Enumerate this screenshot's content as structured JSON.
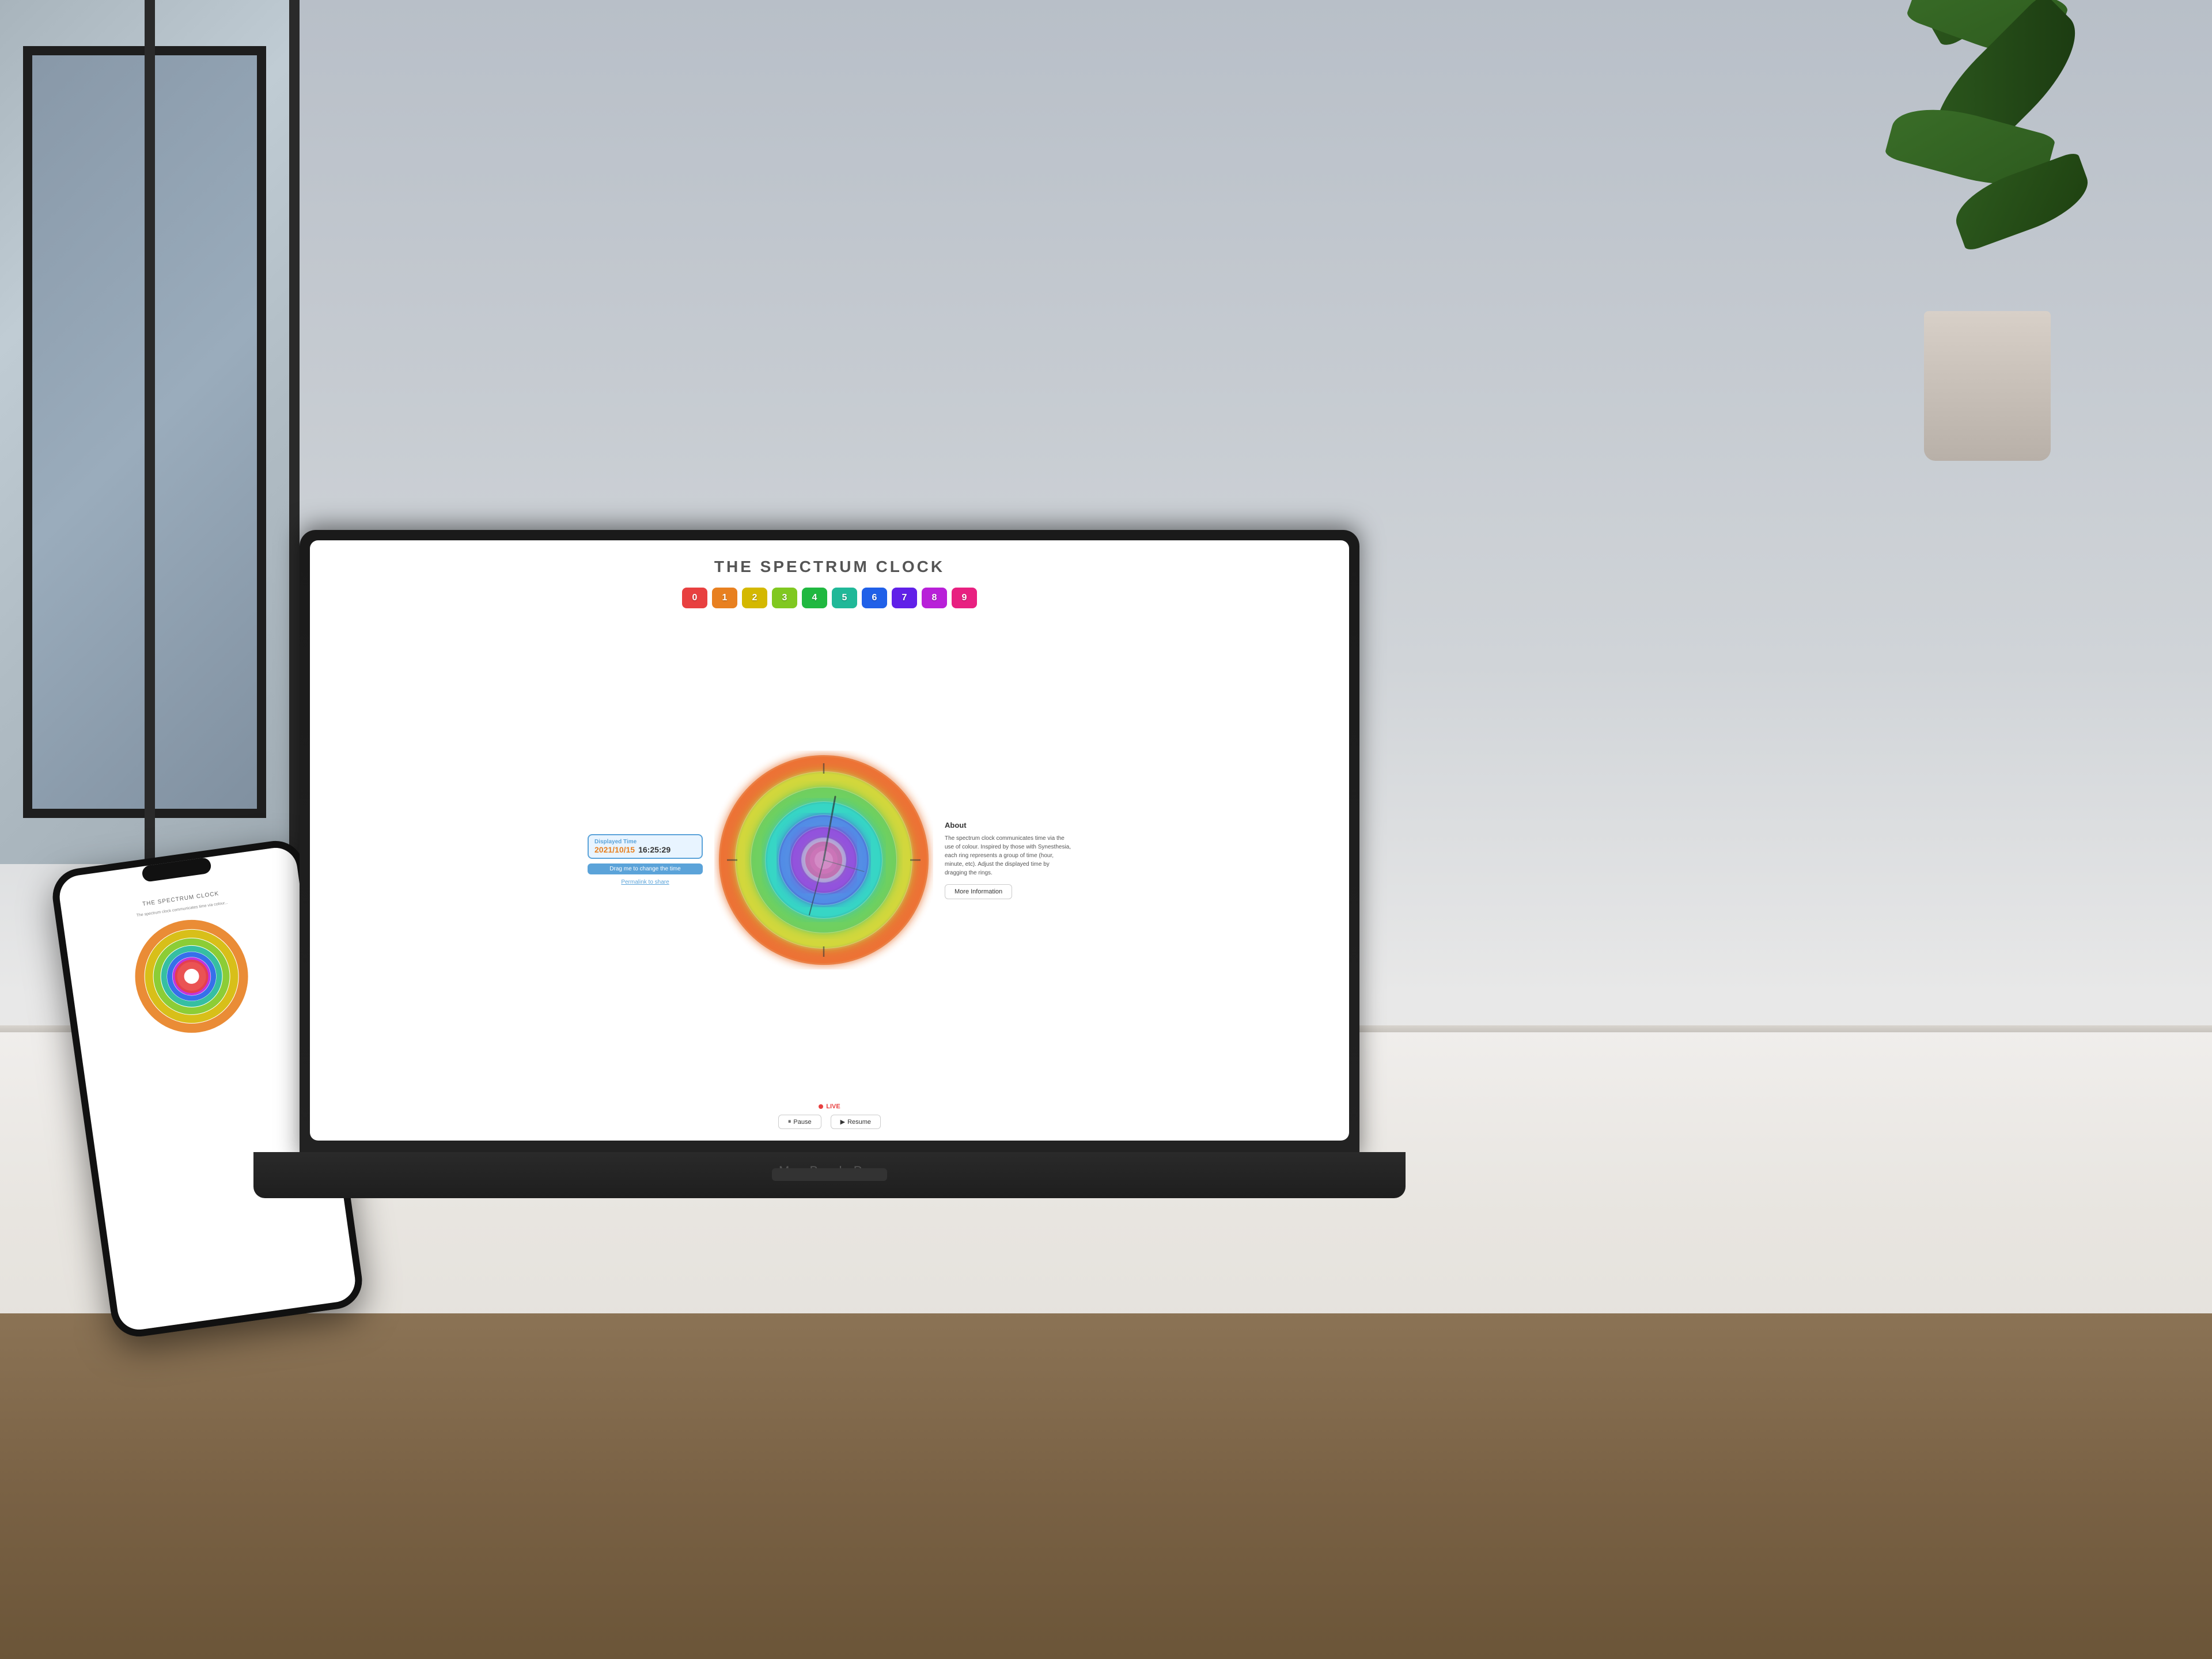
{
  "room": {
    "background": "#c8c8c8"
  },
  "app": {
    "title": "THE SPECTRUM CLOCK",
    "color_buttons": [
      {
        "label": "0",
        "color": "#e84040"
      },
      {
        "label": "1",
        "color": "#e88020"
      },
      {
        "label": "2",
        "color": "#d4b800"
      },
      {
        "label": "3",
        "color": "#80c820"
      },
      {
        "label": "4",
        "color": "#20b840"
      },
      {
        "label": "5",
        "color": "#20b898"
      },
      {
        "label": "6",
        "color": "#2060e8"
      },
      {
        "label": "7",
        "color": "#6020e8"
      },
      {
        "label": "8",
        "color": "#b820d8"
      },
      {
        "label": "9",
        "color": "#e82080"
      }
    ],
    "displayed_time": {
      "label": "Displayed Time",
      "date": "2021/10/15",
      "time": "16:25:29"
    },
    "drag_hint": "Drag me to change the time",
    "share_label": "Permalink to share",
    "about": {
      "title": "About",
      "body": "The spectrum clock communicates time via the use of colour. Inspired by those with Synesthesia, each ring represents a group of time (hour, minute, etc). Adjust the displayed time by dragging the rings.",
      "more_info_label": "More Information"
    },
    "live_label": "LIVE",
    "controls": {
      "pause_label": "Pause",
      "resume_label": "Resume"
    }
  },
  "laptop": {
    "brand": "MacBook Pro"
  },
  "phone": {
    "clock_title": "THE SPECTRUM CLOCK",
    "text": "The spectrum clock communicates time via colour..."
  }
}
